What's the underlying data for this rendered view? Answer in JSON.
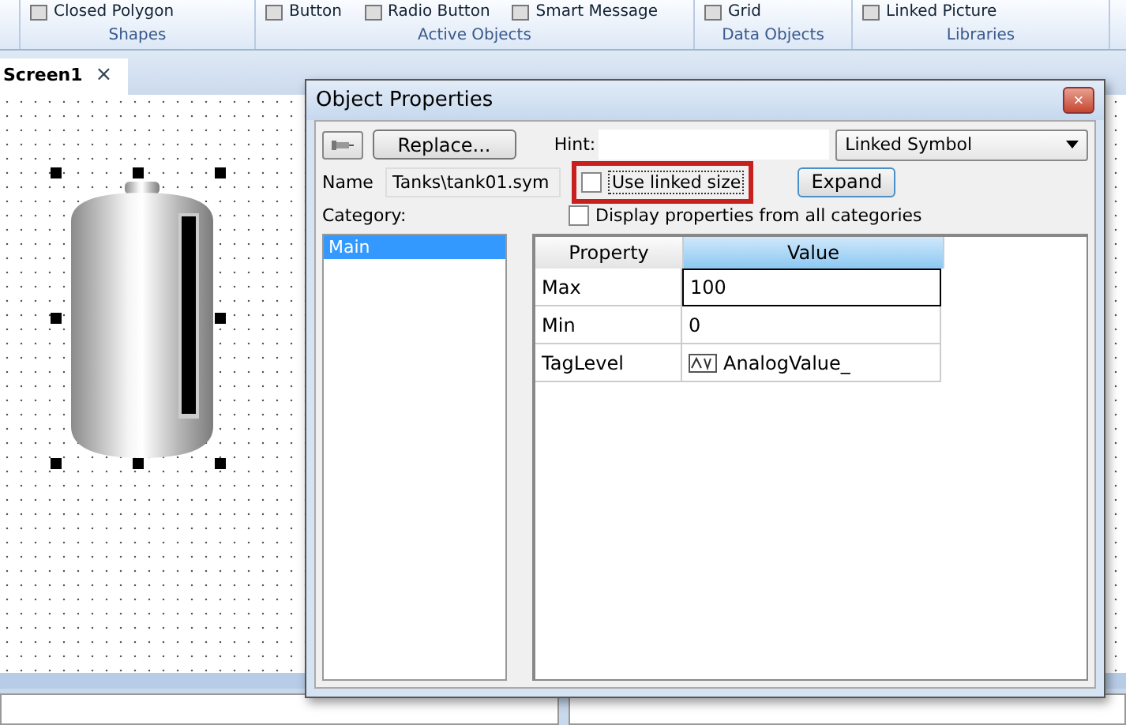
{
  "ribbon": {
    "groups": [
      {
        "label": "Shapes",
        "items": [
          "Closed Polygon"
        ]
      },
      {
        "label": "Active Objects",
        "items": [
          "Button",
          "Radio Button",
          "Smart Message"
        ]
      },
      {
        "label": "Data Objects",
        "items": [
          "Grid"
        ]
      },
      {
        "label": "Libraries",
        "items": [
          "Linked Picture"
        ]
      }
    ]
  },
  "tabs": [
    {
      "label": "Screen1",
      "selected": true,
      "close": "×"
    }
  ],
  "dialog": {
    "title": "Object Properties",
    "close": "×",
    "replace_button": "Replace...",
    "hint_label": "Hint:",
    "dropdown": "Linked Symbol",
    "name_label": "Name",
    "name_value": "Tanks\\tank01.sym",
    "use_linked_size": {
      "label": "Use linked size",
      "checked": false,
      "highlighted": true
    },
    "expand_button": "Expand",
    "display_all": {
      "label": "Display properties from all categories",
      "checked": false
    },
    "category_label": "Category:",
    "categories": [
      {
        "label": "Main",
        "selected": true
      }
    ],
    "grid": {
      "columns": [
        {
          "label": "Property",
          "selected": false
        },
        {
          "label": "Value",
          "selected": true
        }
      ],
      "rows": [
        {
          "property": "Max",
          "value": "100",
          "editing": true,
          "kind": "text"
        },
        {
          "property": "Min",
          "value": "0",
          "editing": false,
          "kind": "text"
        },
        {
          "property": "TagLevel",
          "value": "AnalogValue_",
          "editing": false,
          "kind": "tag"
        }
      ]
    }
  }
}
